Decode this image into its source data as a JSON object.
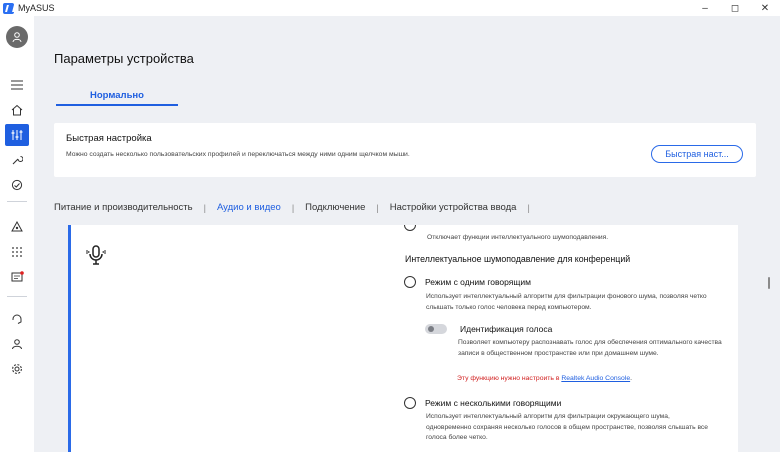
{
  "app": {
    "title": "MyASUS"
  },
  "window": {
    "minimize": "–",
    "maximize": "◻",
    "close": "✕"
  },
  "page": {
    "title": "Параметры устройства"
  },
  "mode_tab": {
    "label": "Нормально"
  },
  "quick_setup": {
    "title": "Быстрая настройка",
    "description": "Можно создать несколько пользовательских профилей и переключаться между ними одним щелчком мыши.",
    "button": "Быстрая наст..."
  },
  "category_tabs": [
    {
      "label": "Питание и производительность"
    },
    {
      "label": "Аудио и видео"
    },
    {
      "label": "Подключение"
    },
    {
      "label": "Настройки устройства ввода"
    }
  ],
  "tab_separator": "|",
  "audio": {
    "prev_option_desc": "Отключает функции интеллектуального шумоподавления.",
    "section_title": "Интеллектуальное шумоподавление для конференций",
    "single_speaker": {
      "label": "Режим с одним говорящим",
      "description": "Использует интеллектуальный алгоритм для фильтрации фонового шума, позволяя четко слышать только голос человека перед компьютером."
    },
    "voice_id": {
      "label": "Идентификация голоса",
      "description": "Позволяет компьютеру распознавать голос для обеспечения оптимального качества записи в общественном пространстве или при домашнем шуме.",
      "enabled": false
    },
    "note": {
      "text": "Эту функцию нужно настроить в ",
      "link": "Realtek Audio Console",
      "suffix": "."
    },
    "multi_speaker": {
      "label": "Режим с несколькими говорящими",
      "description": "Использует интеллектуальный алгоритм для фильтрации окружающего шума, одновременно сохраняя несколько голосов в общем пространстве, позволяя слышать все голоса более четко."
    }
  },
  "colors": {
    "accent": "#1f5fe0",
    "warning": "#d11f1f"
  }
}
